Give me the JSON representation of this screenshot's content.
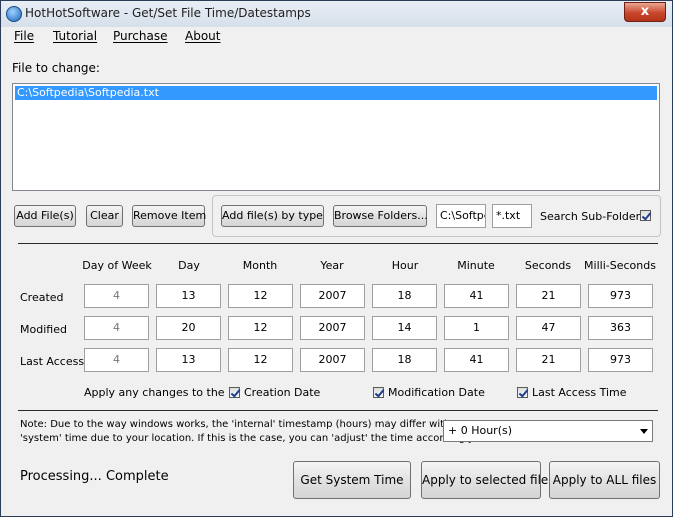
{
  "window": {
    "title": "HotHotSoftware - Get/Set File Time/Datestamps",
    "close_glyph": "x"
  },
  "menu": [
    "File",
    "Tutorial",
    "Purchase",
    "About"
  ],
  "file_section": {
    "label": "File to change:",
    "files": [
      "C:\\Softpedia\\Softpedia.txt"
    ]
  },
  "buttons": {
    "add_files": "Add File(s)",
    "clear": "Clear",
    "remove_item": "Remove Item",
    "add_by_type": "Add file(s) by type",
    "browse_folders": "Browse Folders...",
    "get_system_time": "Get System Time",
    "apply_selected": "Apply to selected file",
    "apply_all": "Apply to ALL files"
  },
  "filter": {
    "folder_value": "C:\\Softpedia",
    "ext_value": "*.txt",
    "search_subfolders_label": "Search Sub-Folders",
    "search_subfolders_checked": true
  },
  "timestamp_table": {
    "columns": [
      "Day of Week",
      "Day",
      "Month",
      "Year",
      "Hour",
      "Minute",
      "Seconds",
      "Milli-Seconds"
    ],
    "rows": [
      {
        "label": "Created",
        "values": [
          "4",
          "13",
          "12",
          "2007",
          "18",
          "41",
          "21",
          "973"
        ]
      },
      {
        "label": "Modified",
        "values": [
          "4",
          "20",
          "12",
          "2007",
          "14",
          "1",
          "47",
          "363"
        ]
      },
      {
        "label": "Last Access",
        "values": [
          "4",
          "13",
          "12",
          "2007",
          "18",
          "41",
          "21",
          "973"
        ]
      }
    ]
  },
  "apply_options": {
    "label": "Apply any changes to the",
    "creation": {
      "label": "Creation Date",
      "checked": true
    },
    "modification": {
      "label": "Modification Date",
      "checked": true
    },
    "last_access": {
      "label": "Last Access Time",
      "checked": true
    }
  },
  "note": {
    "line1": "Note: Due to the way windows works, the 'internal' timestamp (hours) may differ with your",
    "line2": "'system' time due to your location. If this is the case, you can 'adjust' the time accordingly."
  },
  "hour_offset": {
    "selected": "+ 0 Hour(s)"
  },
  "status": "Processing... Complete"
}
